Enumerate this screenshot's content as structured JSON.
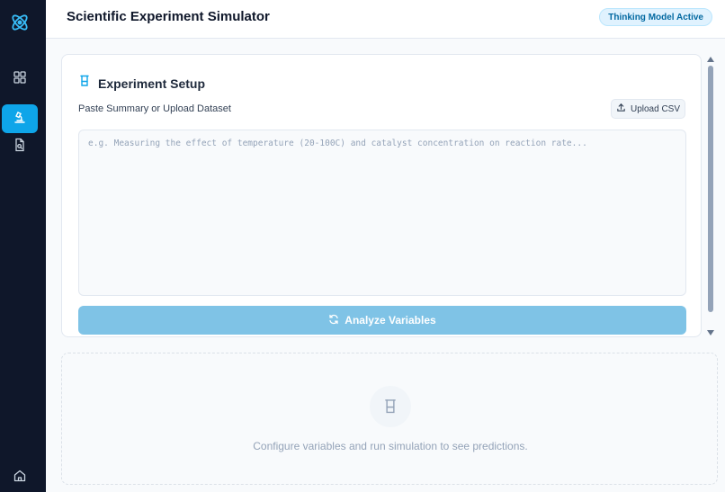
{
  "app": {
    "title": "Scientific Experiment Simulator",
    "status_badge": "Thinking Model Active"
  },
  "sidebar": {
    "items": [
      {
        "icon": "atom-logo-icon"
      },
      {
        "icon": "grid-icon"
      },
      {
        "icon": "microscope-icon",
        "active": true
      },
      {
        "icon": "file-search-icon"
      },
      {
        "icon": "home-icon"
      }
    ]
  },
  "setup": {
    "title": "Experiment Setup",
    "input_label": "Paste Summary or Upload Dataset",
    "upload_label": "Upload CSV",
    "placeholder": "e.g. Measuring the effect of temperature (20-100C) and catalyst concentration on reaction rate...",
    "value": "",
    "analyze_label": "Analyze Variables"
  },
  "results": {
    "empty_message": "Configure variables and run simulation to see predictions."
  },
  "colors": {
    "accent": "#0ea5e9",
    "sidebar_bg": "#0f172a",
    "button_disabled": "#7fc3e6"
  }
}
